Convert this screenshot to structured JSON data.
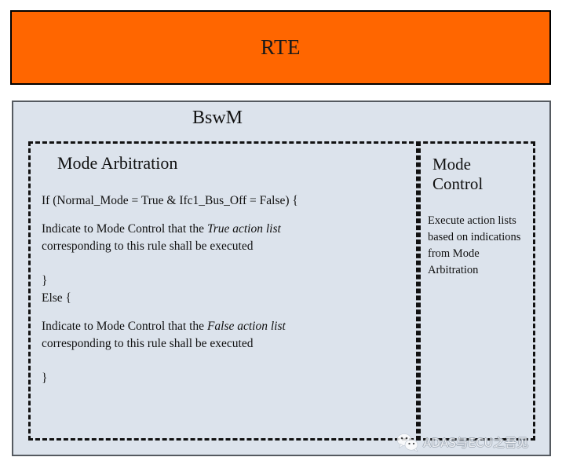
{
  "rte": {
    "label": "RTE",
    "fill_color": "#FF6600"
  },
  "bswm": {
    "title": "BswM",
    "fill_color": "#DCE3EC"
  },
  "mode_arbitration": {
    "title": "Mode Arbitration",
    "code": {
      "if_line": "If (Normal_Mode = True & Ifc1_Bus_Off = False) {",
      "true_text_before": "Indicate to Mode Control that the ",
      "true_text_emphasis": "True action list",
      "true_text_second_line": "corresponding to this rule shall be executed",
      "close_brace_1": "}",
      "else_line": "Else {",
      "false_text_before": "Indicate to Mode Control that the ",
      "false_text_emphasis": "False action list",
      "false_text_second_line": "corresponding to this rule shall be executed",
      "close_brace_2": "}"
    }
  },
  "mode_control": {
    "title_line_1": "Mode",
    "title_line_2": "Control",
    "description": "Execute action lists based on indications from Mode Arbitration"
  },
  "watermark": {
    "text": "ADAS与ECU之吾见",
    "logo": "wechat-icon"
  }
}
